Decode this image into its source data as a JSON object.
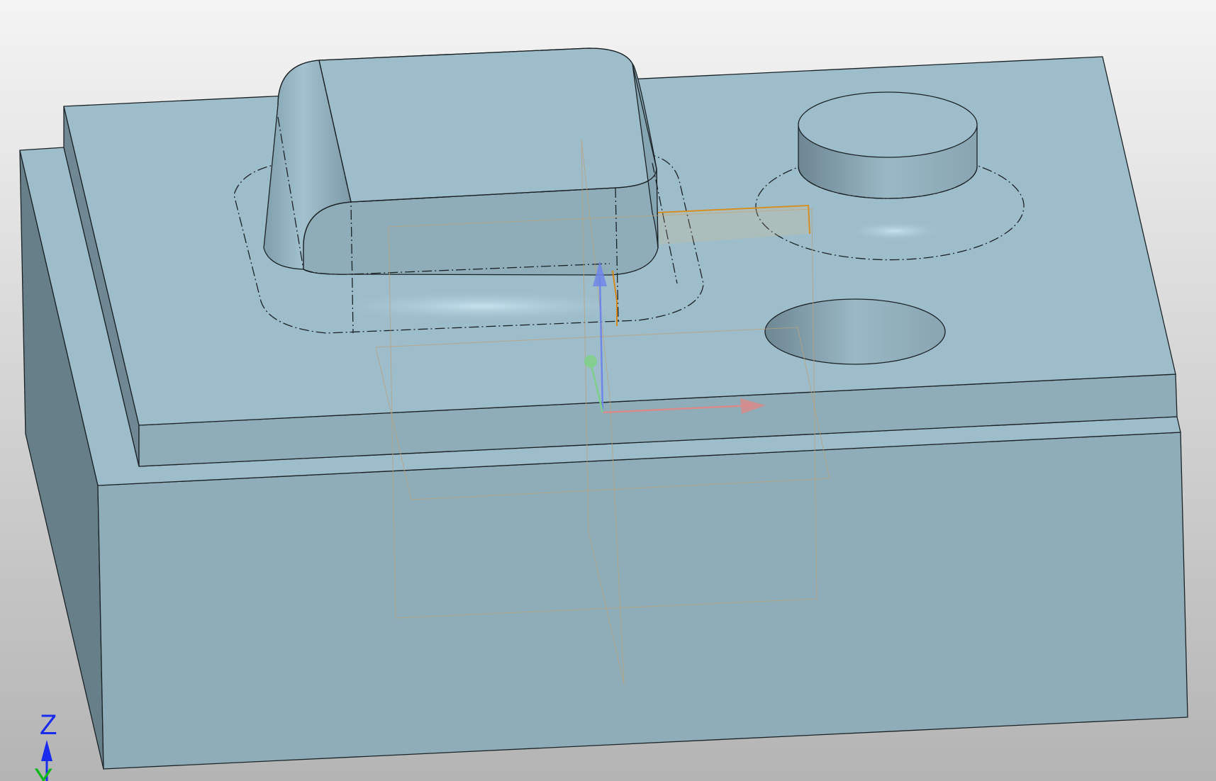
{
  "viewport": {
    "background_top": "#f4f4f4",
    "background_bottom": "#b4b4b4"
  },
  "model": {
    "face_top": "#9ebdcb",
    "face_front": "#8eadb9",
    "face_side": "#667f89",
    "edge_color": "#1b2226"
  },
  "triad": {
    "z_label": "Z",
    "y_label": "Y",
    "z_color": "#1a2bf0",
    "y_color": "#0fb81a"
  },
  "csys": {
    "x_axis_color": "#d98a8a",
    "y_axis_color": "#7fcf8a",
    "z_axis_color": "#6f86e8",
    "datum_plane_color": "#b9a27a",
    "sketch_color": "#d58a1a"
  }
}
